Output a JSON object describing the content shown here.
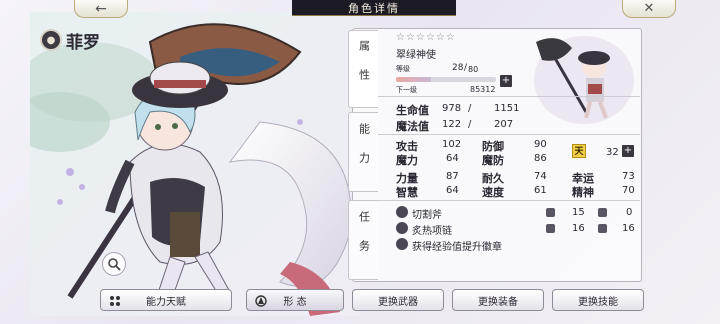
{
  "header": {
    "title": "角色详情",
    "back_icon": "back-arrow-icon",
    "close_icon": "close-icon"
  },
  "character": {
    "name": "菲罗",
    "stars": "☆☆☆☆☆☆",
    "title": "翠绿神使"
  },
  "level": {
    "label": "等级",
    "current": "28",
    "max": "80",
    "progress_ratio": 0.35,
    "next_label": "下一级",
    "next_exp": "85312"
  },
  "side_tabs": [
    {
      "label": "属性"
    },
    {
      "label": "能力"
    },
    {
      "label": "任务"
    }
  ],
  "vitals": {
    "hp_label": "生命值",
    "hp_current": "978",
    "hp_slash": "/",
    "hp_max": "1151",
    "mp_label": "魔法值",
    "mp_current": "122",
    "mp_slash": "/",
    "mp_max": "207"
  },
  "stats": [
    {
      "label": "攻击",
      "value": "102"
    },
    {
      "label": "防御",
      "value": "90"
    },
    {
      "label": "魔力",
      "value": "64"
    },
    {
      "label": "魔防",
      "value": "86"
    },
    {
      "label": "力量",
      "value": "87"
    },
    {
      "label": "耐久",
      "value": "74"
    },
    {
      "label": "幸运",
      "value": "73"
    },
    {
      "label": "智慧",
      "value": "64"
    },
    {
      "label": "速度",
      "value": "61"
    },
    {
      "label": "精神",
      "value": "70"
    }
  ],
  "talent": {
    "badge": "天",
    "value": "32"
  },
  "equipment": [
    {
      "name": "切割斧",
      "stat_a": "15",
      "stat_b": "0"
    },
    {
      "name": "炙热项链",
      "stat_a": "16",
      "stat_b": "16"
    }
  ],
  "badge_hint": "获得经验值提升徽章",
  "buttons": {
    "talent": "能力天赋",
    "form": "形 态",
    "change_weapon": "更换武器",
    "change_equipment": "更换装备",
    "change_skill": "更换技能"
  },
  "colors": {
    "title_bar": "#1c1a22",
    "accent_gold": "#f2d044",
    "panel_border": "#b8b4c0"
  }
}
